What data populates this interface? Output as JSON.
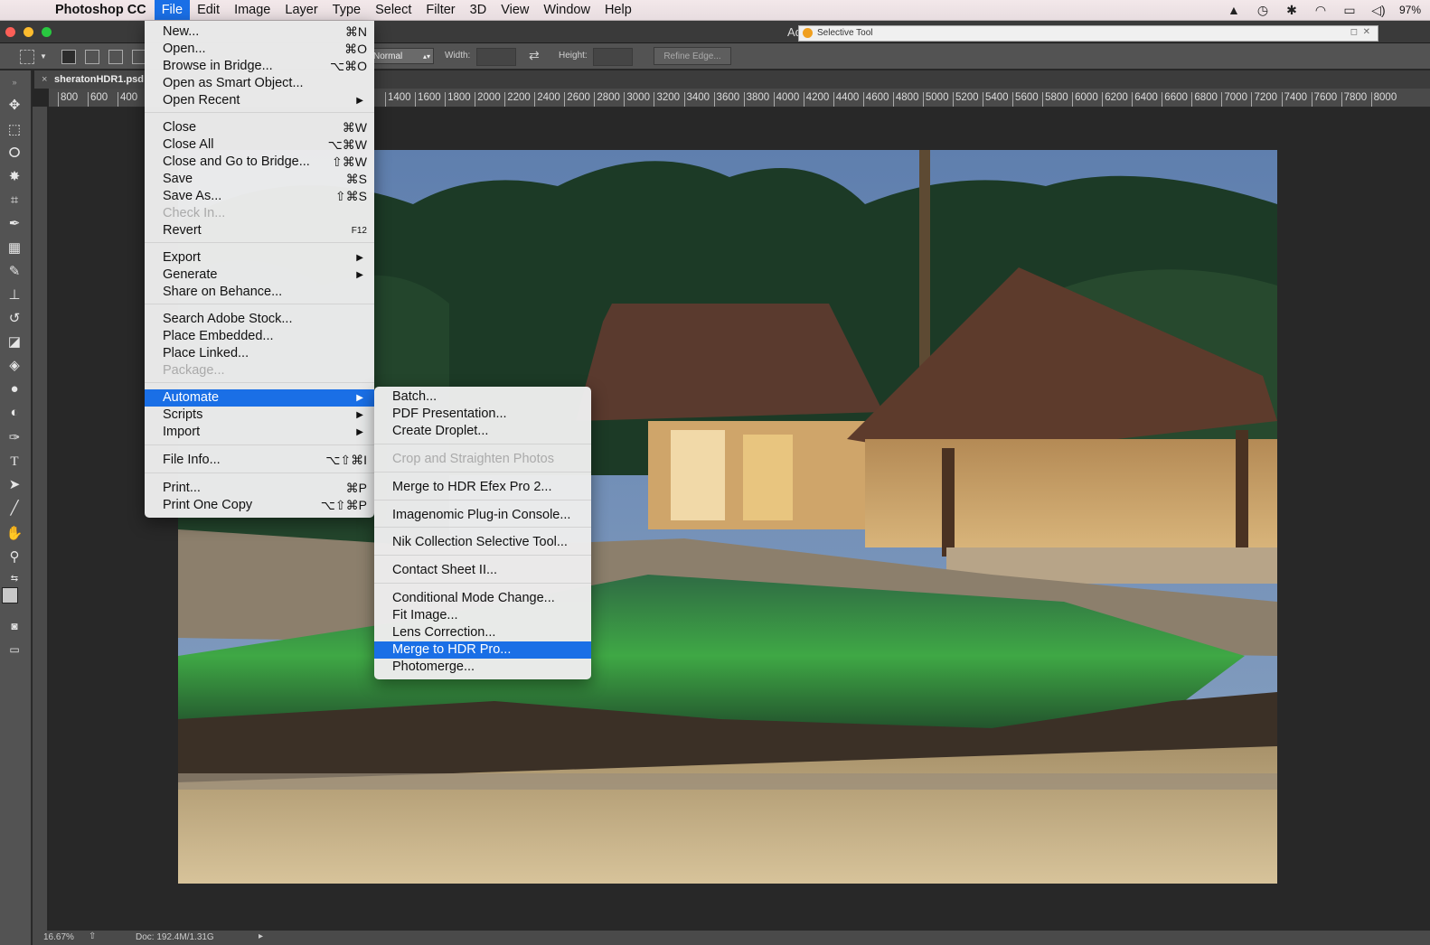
{
  "mac_menubar": {
    "app_name": "Photoshop CC",
    "items": [
      "File",
      "Edit",
      "Image",
      "Layer",
      "Type",
      "Select",
      "Filter",
      "3D",
      "View",
      "Window",
      "Help"
    ],
    "battery": "97%"
  },
  "window": {
    "title_fragment": "Ad",
    "plugin_window_title": "Selective Tool"
  },
  "options_bar": {
    "mode": "Normal",
    "width_label": "Width:",
    "height_label": "Height:",
    "refine_edge": "Refine Edge..."
  },
  "document": {
    "tab_name": "sheratonHDR1.psd",
    "zoom": "16.67%",
    "doc_size": "Doc: 192.4M/1.31G"
  },
  "ruler": {
    "left_ticks": [
      "800",
      "600",
      "400"
    ],
    "ticks": [
      "1400",
      "1600",
      "1800",
      "2000",
      "2200",
      "2400",
      "2600",
      "2800",
      "3000",
      "3200",
      "3400",
      "3600",
      "3800",
      "4000",
      "4200",
      "4400",
      "4600",
      "4800",
      "5000",
      "5200",
      "5400",
      "5600",
      "5800",
      "6000",
      "6200",
      "6400",
      "6600",
      "6800",
      "7000",
      "7200",
      "7400",
      "7600",
      "7800",
      "8000"
    ]
  },
  "file_menu": {
    "items": [
      {
        "label": "New...",
        "shortcut": "⌘N"
      },
      {
        "label": "Open...",
        "shortcut": "⌘O"
      },
      {
        "label": "Browse in Bridge...",
        "shortcut": "⌥⌘O"
      },
      {
        "label": "Open as Smart Object...",
        "shortcut": ""
      },
      {
        "label": "Open Recent",
        "shortcut": "▶"
      },
      {
        "label": "Close",
        "shortcut": "⌘W"
      },
      {
        "label": "Close All",
        "shortcut": "⌥⌘W"
      },
      {
        "label": "Close and Go to Bridge...",
        "shortcut": "⇧⌘W"
      },
      {
        "label": "Save",
        "shortcut": "⌘S"
      },
      {
        "label": "Save As...",
        "shortcut": "⇧⌘S"
      },
      {
        "label": "Check In...",
        "shortcut": ""
      },
      {
        "label": "Revert",
        "shortcut": "F12"
      },
      {
        "label": "Export",
        "shortcut": "▶"
      },
      {
        "label": "Generate",
        "shortcut": "▶"
      },
      {
        "label": "Share on Behance...",
        "shortcut": ""
      },
      {
        "label": "Search Adobe Stock...",
        "shortcut": ""
      },
      {
        "label": "Place Embedded...",
        "shortcut": ""
      },
      {
        "label": "Place Linked...",
        "shortcut": ""
      },
      {
        "label": "Package...",
        "shortcut": ""
      },
      {
        "label": "Automate",
        "shortcut": "▶"
      },
      {
        "label": "Scripts",
        "shortcut": "▶"
      },
      {
        "label": "Import",
        "shortcut": "▶"
      },
      {
        "label": "File Info...",
        "shortcut": "⌥⇧⌘I"
      },
      {
        "label": "Print...",
        "shortcut": "⌘P"
      },
      {
        "label": "Print One Copy",
        "shortcut": "⌥⇧⌘P"
      }
    ]
  },
  "automate_menu": {
    "items": [
      "Batch...",
      "PDF Presentation...",
      "Create Droplet...",
      "Crop and Straighten Photos",
      "Merge to HDR Efex Pro 2...",
      "Imagenomic Plug-in Console...",
      "Nik Collection Selective Tool...",
      "Contact Sheet II...",
      "Conditional Mode Change...",
      "Fit Image...",
      "Lens Correction...",
      "Merge to HDR Pro...",
      "Photomerge..."
    ]
  },
  "colors": {
    "highlight": "#1a6fe6",
    "menu_bg": "#ececec",
    "ps_panel": "#535353"
  }
}
